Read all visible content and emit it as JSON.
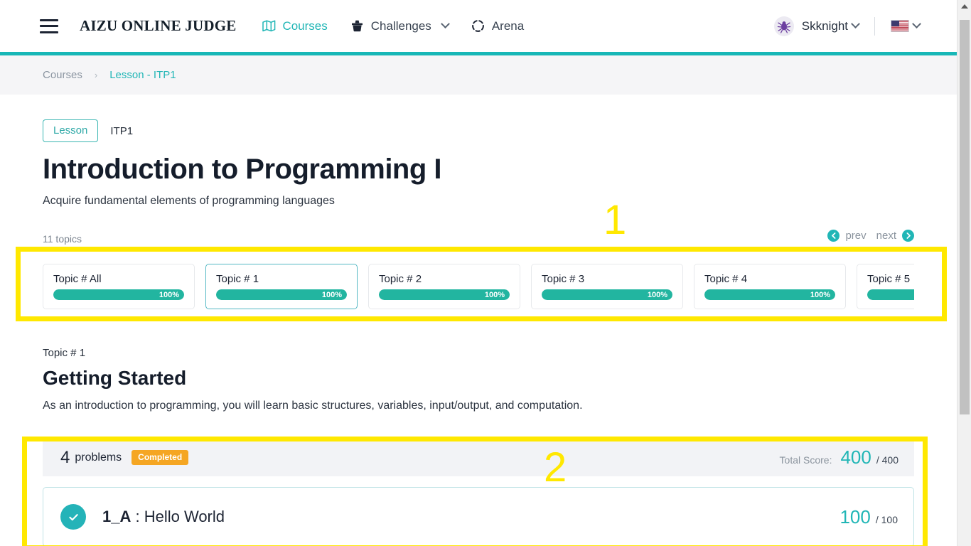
{
  "header": {
    "menu_icon": "hamburger-icon",
    "brand": "AIZU ONLINE JUDGE",
    "nav": [
      {
        "label": "Courses",
        "icon": "map-icon",
        "active": true,
        "caret": false
      },
      {
        "label": "Challenges",
        "icon": "trophy-icon",
        "active": false,
        "caret": true
      },
      {
        "label": "Arena",
        "icon": "dashed-circle-icon",
        "active": false,
        "caret": false
      }
    ],
    "user": {
      "name": "Skknight",
      "avatar_icon": "spider-avatar-icon",
      "caret": true
    },
    "language": {
      "flag_icon": "us-flag-icon",
      "caret": true
    }
  },
  "breadcrumb": {
    "items": [
      "Courses",
      "Lesson - ITP1"
    ],
    "separator": "›"
  },
  "course": {
    "badge": "Lesson",
    "code": "ITP1",
    "title": "Introduction to Programming I",
    "subtitle": "Acquire fundamental elements of programming languages"
  },
  "topics_strip": {
    "count_label": "11 topics",
    "pager": {
      "prev": "prev",
      "next": "next",
      "prev_icon": "chevron-left-circle-icon",
      "next_icon": "chevron-right-circle-icon"
    },
    "cards": [
      {
        "label": "Topic # All",
        "percent": "100%",
        "value": 100,
        "selected": false
      },
      {
        "label": "Topic # 1",
        "percent": "100%",
        "value": 100,
        "selected": true
      },
      {
        "label": "Topic # 2",
        "percent": "100%",
        "value": 100,
        "selected": false
      },
      {
        "label": "Topic # 3",
        "percent": "100%",
        "value": 100,
        "selected": false
      },
      {
        "label": "Topic # 4",
        "percent": "100%",
        "value": 100,
        "selected": false
      },
      {
        "label": "Topic # 5",
        "percent": "100%",
        "value": 100,
        "selected": false
      }
    ]
  },
  "topic": {
    "number": "Topic # 1",
    "title": "Getting Started",
    "description": "As an introduction to programming, you will learn basic structures, variables, input/output, and computation."
  },
  "problems": {
    "count": "4",
    "count_label": "problems",
    "status_badge": "Completed",
    "total_score_label": "Total Score:",
    "total_score_value": "400",
    "total_score_max": "/ 400",
    "rows": [
      {
        "status_icon": "check-circle-icon",
        "id": "1_A",
        "separator": " : ",
        "name": "Hello World",
        "score": "100",
        "score_max": "/ 100"
      }
    ]
  },
  "annotations": [
    {
      "number": "1",
      "target": "topics-strip"
    },
    {
      "number": "2",
      "target": "problems-block"
    }
  ],
  "colors": {
    "teal": "#21b6b6",
    "progress_green": "#22b5a0",
    "badge_orange": "#f5a623",
    "annotation_yellow": "#ffe800",
    "ink": "#1d2433"
  }
}
